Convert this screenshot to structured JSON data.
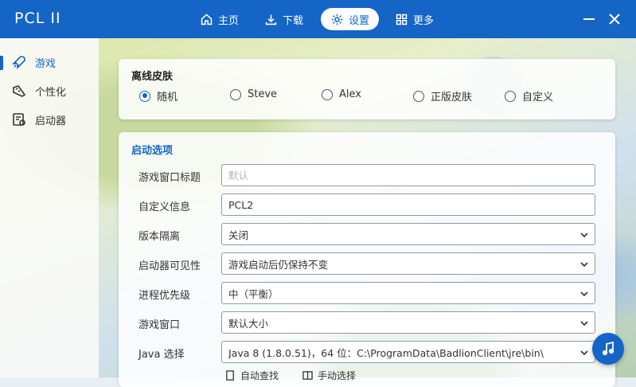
{
  "app": {
    "title": "PCL II"
  },
  "nav": {
    "home": "主页",
    "download": "下载",
    "settings": "设置",
    "more": "更多"
  },
  "sidebar": {
    "items": [
      {
        "label": "游戏",
        "icon": "rocket-icon",
        "active": true
      },
      {
        "label": "个性化",
        "icon": "palette-icon",
        "active": false
      },
      {
        "label": "启动器",
        "icon": "launcher-icon",
        "active": false
      }
    ]
  },
  "skin": {
    "title": "离线皮肤",
    "options": [
      "随机",
      "Steve",
      "Alex",
      "正版皮肤",
      "自定义"
    ],
    "selected": "随机"
  },
  "launch": {
    "title": "启动选项",
    "rows": [
      {
        "label": "游戏窗口标题",
        "placeholder": "默认",
        "value": ""
      },
      {
        "label": "自定义信息",
        "value": "PCL2"
      },
      {
        "label": "版本隔离",
        "value": "关闭"
      },
      {
        "label": "启动器可见性",
        "value": "游戏启动后仍保持不变"
      },
      {
        "label": "进程优先级",
        "value": "中（平衡）"
      },
      {
        "label": "游戏窗口",
        "value": "默认大小"
      },
      {
        "label": "Java 选择",
        "value": "Java 8 (1.8.0.51)，64 位：C:\\ProgramData\\BadlionClient\\jre\\bin\\"
      }
    ],
    "auto_search": "自动查找",
    "manual_select": "手动选择"
  },
  "colors": {
    "accent": "#1565c6",
    "titlebar": "#1565c6"
  }
}
